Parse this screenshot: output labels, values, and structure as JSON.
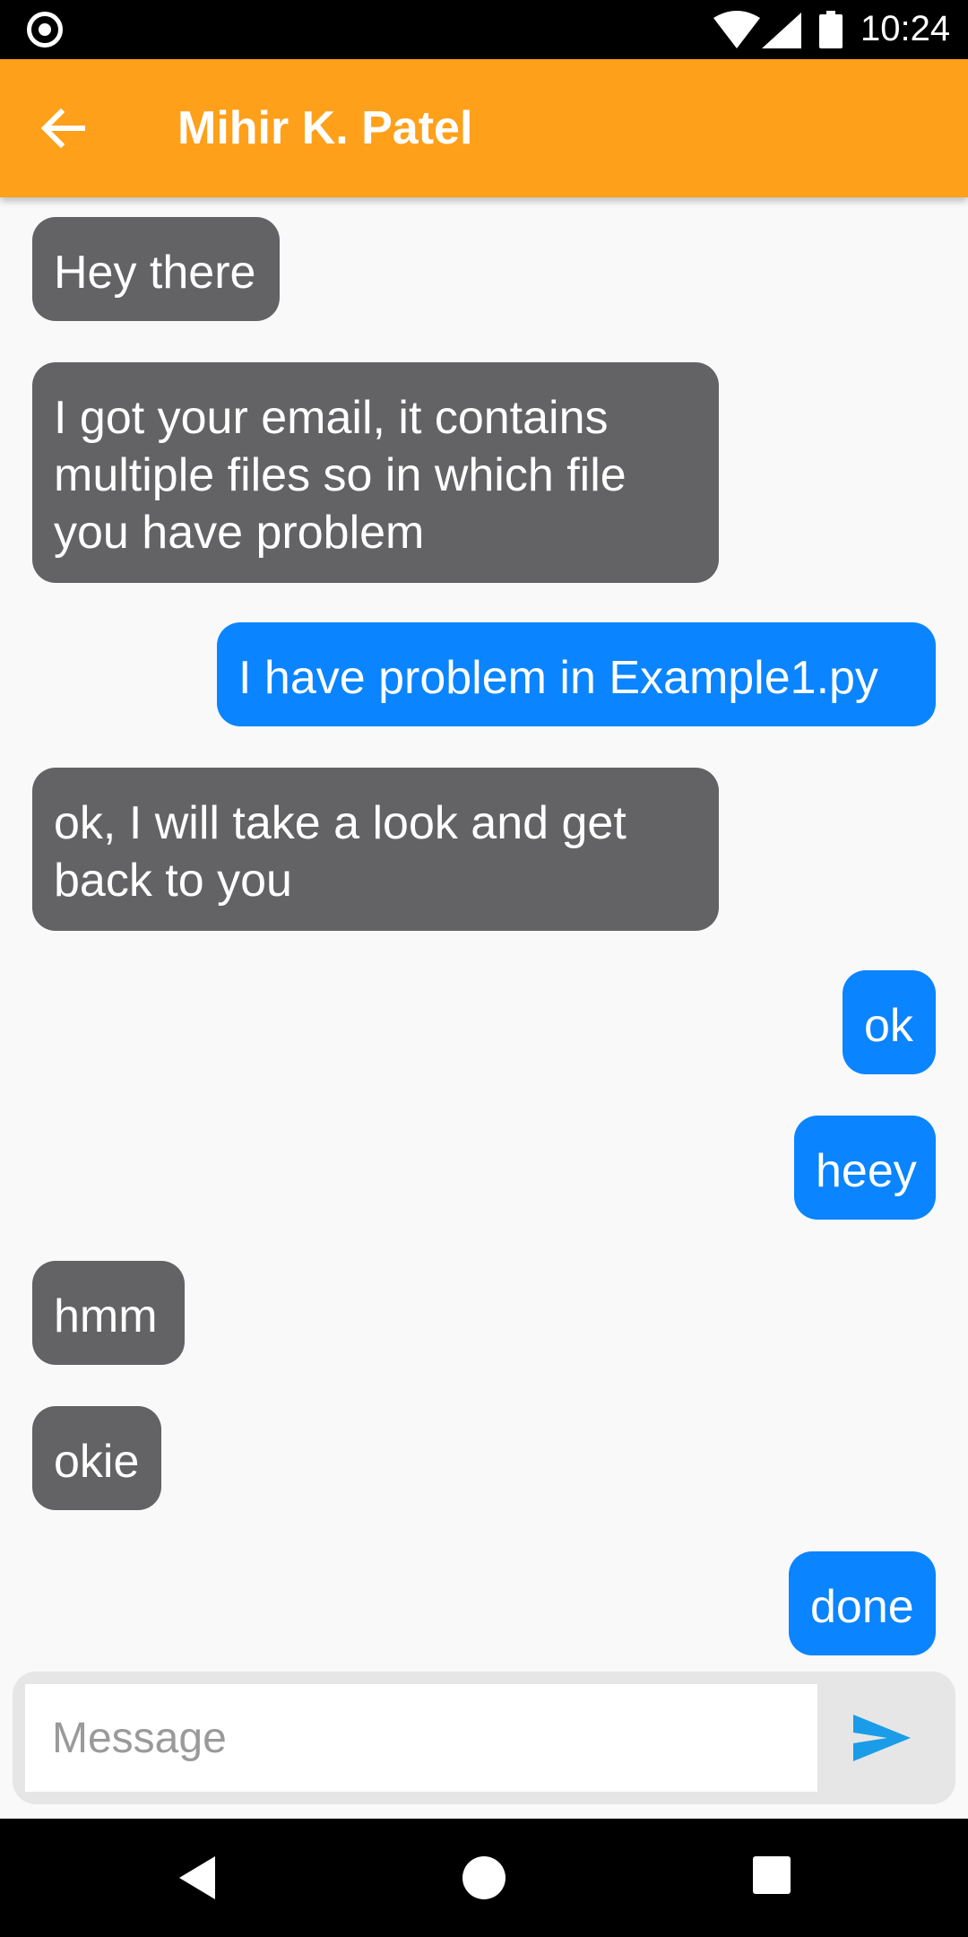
{
  "status_bar": {
    "time": "10:24",
    "icons": [
      "camera-icon",
      "wifi-icon",
      "signal-icon",
      "battery-icon"
    ]
  },
  "app_bar": {
    "title": "Mihir K. Patel",
    "back_icon": "arrow-left-icon",
    "color": "#ffa01a"
  },
  "messages": [
    {
      "side": "in",
      "text": "Hey there"
    },
    {
      "side": "in",
      "text": "I got your email, it contains multiple files so in which file you have problem"
    },
    {
      "side": "out",
      "text": "I have problem in Example1.py"
    },
    {
      "side": "in",
      "text": "ok, I will take a look and get back to you"
    },
    {
      "side": "out",
      "text": "ok"
    },
    {
      "side": "out",
      "text": "heey"
    },
    {
      "side": "in",
      "text": "hmm"
    },
    {
      "side": "in",
      "text": "okie"
    },
    {
      "side": "out",
      "text": "done"
    }
  ],
  "colors": {
    "incoming_bubble": "#636365",
    "outgoing_bubble": "#0a84ff",
    "send_icon": "#1a9ce8"
  },
  "composer": {
    "placeholder": "Message",
    "value": "",
    "send_icon": "send-icon"
  },
  "nav_bar": {
    "icons": [
      "back-triangle-icon",
      "home-circle-icon",
      "recents-square-icon"
    ]
  }
}
